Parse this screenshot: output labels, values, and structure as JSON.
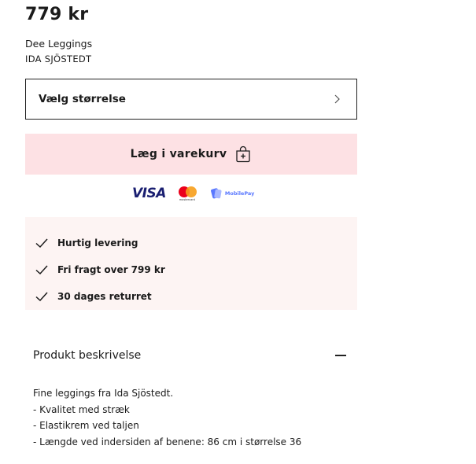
{
  "product": {
    "price": "779 kr",
    "name": "Dee Leggings",
    "brand": "IDA SJÖSTEDT"
  },
  "size_select": {
    "label": "Vælg størrelse",
    "icon": "chevron-right-icon"
  },
  "cart": {
    "label": "Læg i varekurv",
    "icon": "shopping-bag-plus-icon",
    "background": "#fde1e4"
  },
  "payments": {
    "visa": "VISA",
    "mastercard": "mastercard",
    "mobilepay": "MobilePay"
  },
  "usps": {
    "background": "#fdf4f3",
    "items": [
      {
        "text": "Hurtig levering",
        "icon": "check-icon"
      },
      {
        "text": "Fri fragt over 799 kr",
        "icon": "check-icon"
      },
      {
        "text": "30 dages returret",
        "icon": "check-icon"
      }
    ]
  },
  "description": {
    "title": "Produkt beskrivelse",
    "toggle_icon": "minus-icon",
    "lines": [
      "Fine leggings fra Ida Sjöstedt.",
      "- Kvalitet med stræk",
      "- Elastikrem ved taljen",
      "- Længde ved indersiden af benene: 86 cm i størrelse 36"
    ]
  }
}
